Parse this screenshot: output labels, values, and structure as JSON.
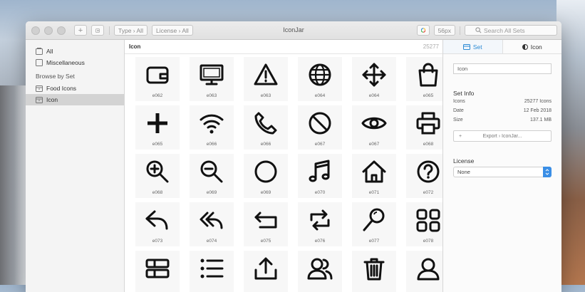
{
  "window": {
    "title": "IconJar"
  },
  "toolbar": {
    "add_label": "+",
    "filter_type": "Type › All",
    "filter_license": "License › All",
    "size_label": "56px",
    "search_placeholder": "Search All Sets"
  },
  "sidebar": {
    "items_top": [
      {
        "label": "All",
        "icon": "all-icon"
      },
      {
        "label": "Miscellaneous",
        "icon": "folder-icon"
      }
    ],
    "browse_heading": "Browse by Set",
    "sets": [
      {
        "label": "Food Icons",
        "icon": "set-icon",
        "selected": false
      },
      {
        "label": "Icon",
        "icon": "set-icon",
        "selected": true
      }
    ]
  },
  "main": {
    "header_label": "Icon",
    "header_count": "25277",
    "icons": [
      {
        "code": "e062",
        "icon": "wallet-icon"
      },
      {
        "code": "e063",
        "icon": "monitor-icon"
      },
      {
        "code": "e063",
        "icon": "warning-icon"
      },
      {
        "code": "e064",
        "icon": "globe-icon"
      },
      {
        "code": "e064",
        "icon": "move-icon"
      },
      {
        "code": "e065",
        "icon": "shopping-bag-icon"
      },
      {
        "code": "e065",
        "icon": "plus-icon"
      },
      {
        "code": "e066",
        "icon": "wifi-icon"
      },
      {
        "code": "e066",
        "icon": "phone-icon"
      },
      {
        "code": "e067",
        "icon": "ban-icon"
      },
      {
        "code": "e067",
        "icon": "eye-icon"
      },
      {
        "code": "e068",
        "icon": "printer-icon"
      },
      {
        "code": "e068",
        "icon": "zoom-in-icon"
      },
      {
        "code": "e069",
        "icon": "zoom-out-icon"
      },
      {
        "code": "e069",
        "icon": "circle-icon"
      },
      {
        "code": "e070",
        "icon": "music-note-icon"
      },
      {
        "code": "e071",
        "icon": "home-icon"
      },
      {
        "code": "e072",
        "icon": "help-icon"
      },
      {
        "code": "e073",
        "icon": "reply-icon"
      },
      {
        "code": "e074",
        "icon": "reply-all-icon"
      },
      {
        "code": "e075",
        "icon": "return-icon"
      },
      {
        "code": "e076",
        "icon": "retweet-icon"
      },
      {
        "code": "e077",
        "icon": "search-icon"
      },
      {
        "code": "e078",
        "icon": "grid-icon"
      },
      {
        "code": "",
        "icon": "list-view-icon"
      },
      {
        "code": "",
        "icon": "list-icon"
      },
      {
        "code": "",
        "icon": "upload-icon"
      },
      {
        "code": "",
        "icon": "users-icon"
      },
      {
        "code": "",
        "icon": "trash-icon"
      },
      {
        "code": "",
        "icon": "user-icon"
      }
    ]
  },
  "inspector": {
    "tabs": [
      {
        "label": "Set",
        "icon": "set-tab-icon",
        "active": true
      },
      {
        "label": "Icon",
        "icon": "icon-tab-icon",
        "active": false
      }
    ],
    "name_value": "Icon",
    "set_info_title": "Set Info",
    "info": [
      {
        "key": "Icons",
        "value": "25277 Icons"
      },
      {
        "key": "Date",
        "value": "12 Feb 2018"
      },
      {
        "key": "Size",
        "value": "137.1 MB"
      }
    ],
    "export_plus": "+",
    "export_label": "Export › IconJar...",
    "license_title": "License",
    "license_value": "None"
  },
  "colors": {
    "accent": "#2a8ad4",
    "select_arrow": "#3a8ee6"
  }
}
